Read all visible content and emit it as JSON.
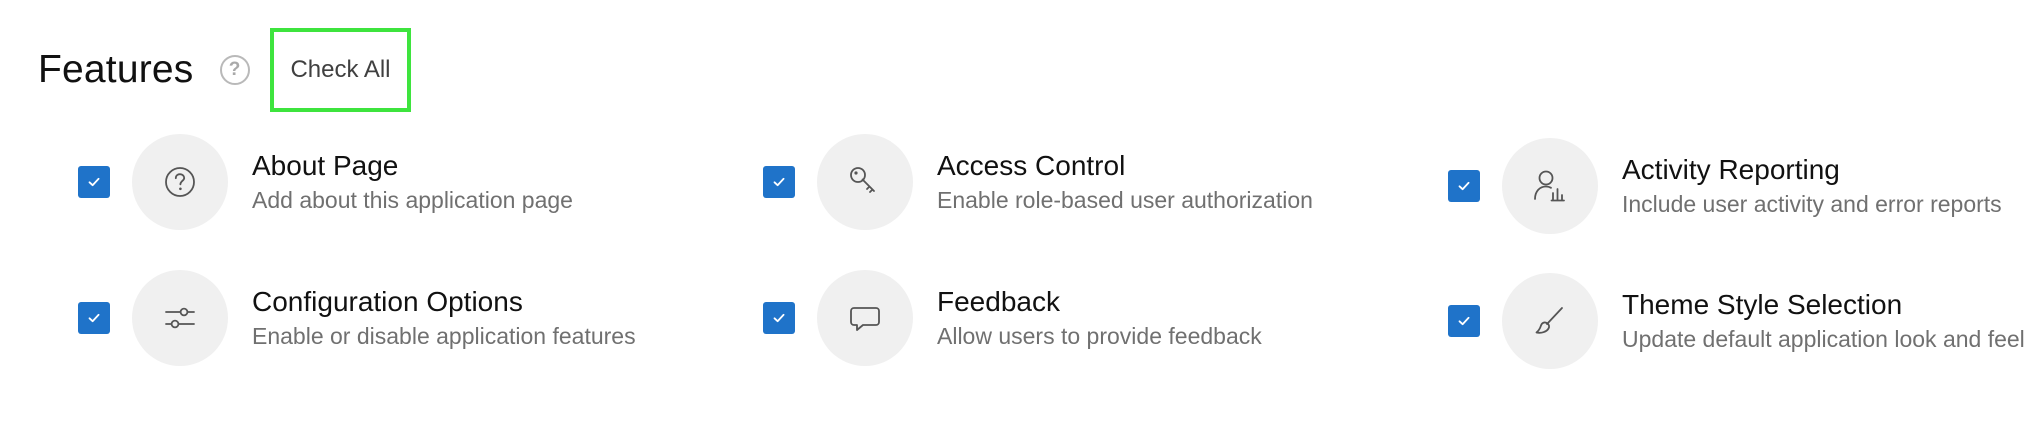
{
  "header": {
    "title": "Features",
    "help_icon": "question-circle-icon",
    "check_all_label": "Check All"
  },
  "colors": {
    "checkbox": "#1f73c9",
    "icon_circle": "#f0f0f0",
    "highlight_border": "#3ee43e",
    "description_text": "#707070"
  },
  "features": [
    {
      "title": "About Page",
      "description": "Add about this application page",
      "checked": true,
      "icon": "question-circle-icon"
    },
    {
      "title": "Access Control",
      "description": "Enable role-based user authorization",
      "checked": true,
      "icon": "key-icon"
    },
    {
      "title": "Activity Reporting",
      "description": "Include user activity and error reports",
      "checked": true,
      "icon": "user-chart-icon"
    },
    {
      "title": "Configuration Options",
      "description": "Enable or disable application features",
      "checked": true,
      "icon": "sliders-icon"
    },
    {
      "title": "Feedback",
      "description": "Allow users to provide feedback",
      "checked": true,
      "icon": "speech-bubble-icon"
    },
    {
      "title": "Theme Style Selection",
      "description": "Update default application look and feel",
      "checked": true,
      "icon": "paintbrush-icon"
    }
  ]
}
